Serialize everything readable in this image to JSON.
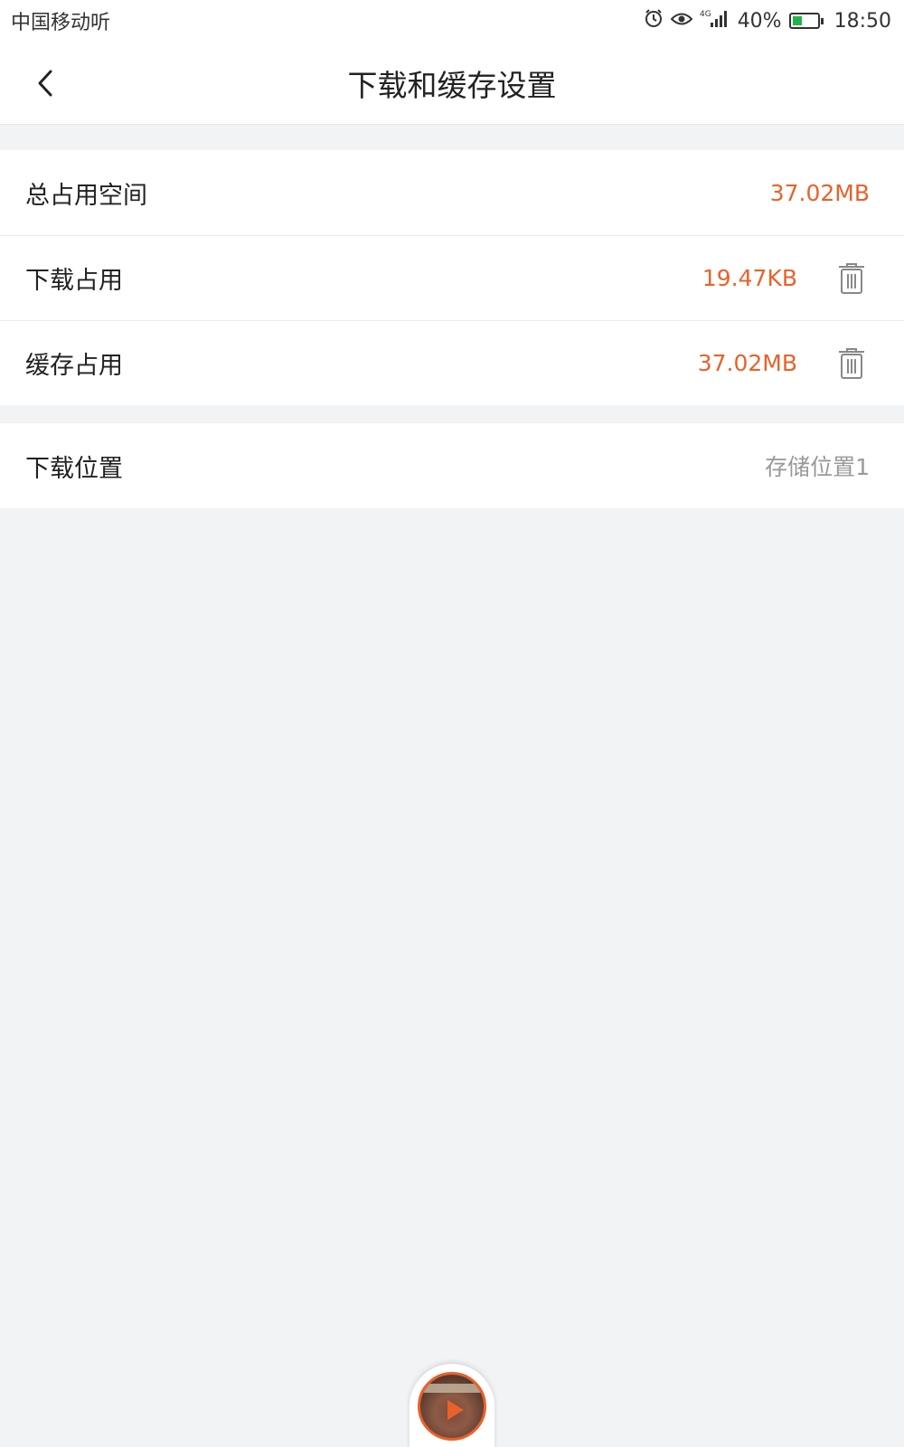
{
  "status_bar": {
    "carrier": "中国移动听",
    "network": "4G",
    "battery": "40%",
    "battery_level": 0.4,
    "time": "18:50"
  },
  "header": {
    "title": "下载和缓存设置"
  },
  "storage": {
    "total": {
      "label": "总占用空间",
      "value": "37.02MB"
    },
    "download": {
      "label": "下载占用",
      "value": "19.47KB"
    },
    "cache": {
      "label": "缓存占用",
      "value": "37.02MB"
    }
  },
  "location": {
    "label": "下载位置",
    "value": "存储位置1"
  },
  "colors": {
    "accent": "#e8622a",
    "background": "#f2f3f5"
  }
}
